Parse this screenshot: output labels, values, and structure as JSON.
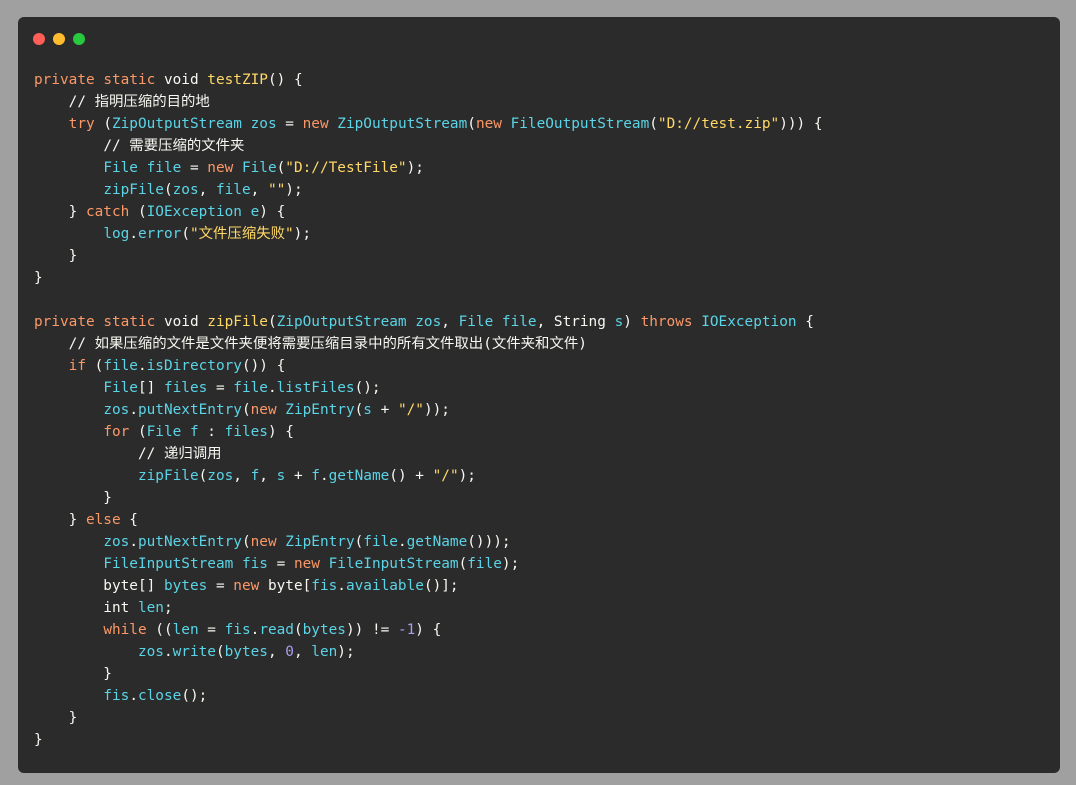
{
  "window": {
    "dots": [
      {
        "name": "close-dot",
        "color": "#ff5f56"
      },
      {
        "name": "minimize-dot",
        "color": "#ffbd2e"
      },
      {
        "name": "maximize-dot",
        "color": "#27c93f"
      }
    ]
  },
  "colors": {
    "background": "#2b2b2b",
    "keyword": "#fc9867",
    "function": "#ffd866",
    "type": "#5ad4e6",
    "string": "#ffd866",
    "number": "#ab9df2",
    "plain": "#f8f8f2"
  },
  "code": {
    "lines": [
      [
        [
          "kw",
          "private"
        ],
        [
          "pl",
          " "
        ],
        [
          "kw",
          "static"
        ],
        [
          "pl",
          " void "
        ],
        [
          "fn",
          "testZIP"
        ],
        [
          "pl",
          "() {"
        ]
      ],
      [
        [
          "pl",
          "    "
        ],
        [
          "cm",
          "// 指明压缩的目的地"
        ]
      ],
      [
        [
          "pl",
          "    "
        ],
        [
          "kw",
          "try"
        ],
        [
          "pl",
          " ("
        ],
        [
          "type",
          "ZipOutputStream"
        ],
        [
          "pl",
          " "
        ],
        [
          "var",
          "zos"
        ],
        [
          "pl",
          " = "
        ],
        [
          "kw",
          "new"
        ],
        [
          "pl",
          " "
        ],
        [
          "type",
          "ZipOutputStream"
        ],
        [
          "pl",
          "("
        ],
        [
          "kw",
          "new"
        ],
        [
          "pl",
          " "
        ],
        [
          "type",
          "FileOutputStream"
        ],
        [
          "pl",
          "("
        ],
        [
          "str",
          "\"D://test.zip\""
        ],
        [
          "pl",
          ")))"
        ],
        [
          "pl",
          " {"
        ]
      ],
      [
        [
          "pl",
          "        "
        ],
        [
          "cm",
          "// 需要压缩的文件夹"
        ]
      ],
      [
        [
          "pl",
          "        "
        ],
        [
          "type",
          "File"
        ],
        [
          "pl",
          " "
        ],
        [
          "var",
          "file"
        ],
        [
          "pl",
          " = "
        ],
        [
          "kw",
          "new"
        ],
        [
          "pl",
          " "
        ],
        [
          "type",
          "File"
        ],
        [
          "pl",
          "("
        ],
        [
          "str",
          "\"D://TestFile\""
        ],
        [
          "pl",
          ");"
        ]
      ],
      [
        [
          "pl",
          "        "
        ],
        [
          "var",
          "zipFile"
        ],
        [
          "pl",
          "("
        ],
        [
          "var",
          "zos"
        ],
        [
          "pl",
          ", "
        ],
        [
          "var",
          "file"
        ],
        [
          "pl",
          ", "
        ],
        [
          "str",
          "\"\""
        ],
        [
          "pl",
          ");"
        ]
      ],
      [
        [
          "pl",
          "    } "
        ],
        [
          "kw",
          "catch"
        ],
        [
          "pl",
          " ("
        ],
        [
          "type",
          "IOException"
        ],
        [
          "pl",
          " "
        ],
        [
          "var",
          "e"
        ],
        [
          "pl",
          ") {"
        ]
      ],
      [
        [
          "pl",
          "        "
        ],
        [
          "var",
          "log"
        ],
        [
          "pl",
          "."
        ],
        [
          "var",
          "error"
        ],
        [
          "pl",
          "("
        ],
        [
          "str",
          "\"文件压缩失败\""
        ],
        [
          "pl",
          ");"
        ]
      ],
      [
        [
          "pl",
          "    }"
        ]
      ],
      [
        [
          "pl",
          "}"
        ]
      ],
      [
        [
          "pl",
          ""
        ]
      ],
      [
        [
          "kw",
          "private"
        ],
        [
          "pl",
          " "
        ],
        [
          "kw",
          "static"
        ],
        [
          "pl",
          " void "
        ],
        [
          "fn",
          "zipFile"
        ],
        [
          "pl",
          "("
        ],
        [
          "type",
          "ZipOutputStream"
        ],
        [
          "pl",
          " "
        ],
        [
          "var",
          "zos"
        ],
        [
          "pl",
          ", "
        ],
        [
          "type",
          "File"
        ],
        [
          "pl",
          " "
        ],
        [
          "var",
          "file"
        ],
        [
          "pl",
          ", String "
        ],
        [
          "var",
          "s"
        ],
        [
          "pl",
          ") "
        ],
        [
          "kw",
          "throws"
        ],
        [
          "pl",
          " "
        ],
        [
          "type",
          "IOException"
        ],
        [
          "pl",
          " {"
        ]
      ],
      [
        [
          "pl",
          "    "
        ],
        [
          "cm",
          "// 如果压缩的文件是文件夹便将需要压缩目录中的所有文件取出(文件夹和文件)"
        ]
      ],
      [
        [
          "pl",
          "    "
        ],
        [
          "kw",
          "if"
        ],
        [
          "pl",
          " ("
        ],
        [
          "var",
          "file"
        ],
        [
          "pl",
          "."
        ],
        [
          "var",
          "isDirectory"
        ],
        [
          "pl",
          "()) {"
        ]
      ],
      [
        [
          "pl",
          "        "
        ],
        [
          "type",
          "File"
        ],
        [
          "pl",
          "[] "
        ],
        [
          "var",
          "files"
        ],
        [
          "pl",
          " = "
        ],
        [
          "var",
          "file"
        ],
        [
          "pl",
          "."
        ],
        [
          "var",
          "listFiles"
        ],
        [
          "pl",
          "();"
        ]
      ],
      [
        [
          "pl",
          "        "
        ],
        [
          "var",
          "zos"
        ],
        [
          "pl",
          "."
        ],
        [
          "var",
          "putNextEntry"
        ],
        [
          "pl",
          "("
        ],
        [
          "kw",
          "new"
        ],
        [
          "pl",
          " "
        ],
        [
          "type",
          "ZipEntry"
        ],
        [
          "pl",
          "("
        ],
        [
          "var",
          "s"
        ],
        [
          "pl",
          " + "
        ],
        [
          "str",
          "\"/\""
        ],
        [
          "pl",
          "));"
        ]
      ],
      [
        [
          "pl",
          "        "
        ],
        [
          "kw",
          "for"
        ],
        [
          "pl",
          " ("
        ],
        [
          "type",
          "File"
        ],
        [
          "pl",
          " "
        ],
        [
          "var",
          "f"
        ],
        [
          "pl",
          " : "
        ],
        [
          "var",
          "files"
        ],
        [
          "pl",
          ") {"
        ]
      ],
      [
        [
          "pl",
          "            "
        ],
        [
          "cm",
          "// 递归调用"
        ]
      ],
      [
        [
          "pl",
          "            "
        ],
        [
          "var",
          "zipFile"
        ],
        [
          "pl",
          "("
        ],
        [
          "var",
          "zos"
        ],
        [
          "pl",
          ", "
        ],
        [
          "var",
          "f"
        ],
        [
          "pl",
          ", "
        ],
        [
          "var",
          "s"
        ],
        [
          "pl",
          " + "
        ],
        [
          "var",
          "f"
        ],
        [
          "pl",
          "."
        ],
        [
          "var",
          "getName"
        ],
        [
          "pl",
          "() + "
        ],
        [
          "str",
          "\"/\""
        ],
        [
          "pl",
          ");"
        ]
      ],
      [
        [
          "pl",
          "        }"
        ]
      ],
      [
        [
          "pl",
          "    } "
        ],
        [
          "kw",
          "else"
        ],
        [
          "pl",
          " {"
        ]
      ],
      [
        [
          "pl",
          "        "
        ],
        [
          "var",
          "zos"
        ],
        [
          "pl",
          "."
        ],
        [
          "var",
          "putNextEntry"
        ],
        [
          "pl",
          "("
        ],
        [
          "kw",
          "new"
        ],
        [
          "pl",
          " "
        ],
        [
          "type",
          "ZipEntry"
        ],
        [
          "pl",
          "("
        ],
        [
          "var",
          "file"
        ],
        [
          "pl",
          "."
        ],
        [
          "var",
          "getName"
        ],
        [
          "pl",
          "()));"
        ]
      ],
      [
        [
          "pl",
          "        "
        ],
        [
          "type",
          "FileInputStream"
        ],
        [
          "pl",
          " "
        ],
        [
          "var",
          "fis"
        ],
        [
          "pl",
          " = "
        ],
        [
          "kw",
          "new"
        ],
        [
          "pl",
          " "
        ],
        [
          "type",
          "FileInputStream"
        ],
        [
          "pl",
          "("
        ],
        [
          "var",
          "file"
        ],
        [
          "pl",
          ");"
        ]
      ],
      [
        [
          "pl",
          "        byte[] "
        ],
        [
          "var",
          "bytes"
        ],
        [
          "pl",
          " = "
        ],
        [
          "kw",
          "new"
        ],
        [
          "pl",
          " byte["
        ],
        [
          "var",
          "fis"
        ],
        [
          "pl",
          "."
        ],
        [
          "var",
          "available"
        ],
        [
          "pl",
          "()];"
        ]
      ],
      [
        [
          "pl",
          "        int "
        ],
        [
          "var",
          "len"
        ],
        [
          "pl",
          ";"
        ]
      ],
      [
        [
          "pl",
          "        "
        ],
        [
          "kw",
          "while"
        ],
        [
          "pl",
          " (("
        ],
        [
          "var",
          "len"
        ],
        [
          "pl",
          " = "
        ],
        [
          "var",
          "fis"
        ],
        [
          "pl",
          "."
        ],
        [
          "var",
          "read"
        ],
        [
          "pl",
          "("
        ],
        [
          "var",
          "bytes"
        ],
        [
          "pl",
          ")) != "
        ],
        [
          "num",
          "-1"
        ],
        [
          "pl",
          ") {"
        ]
      ],
      [
        [
          "pl",
          "            "
        ],
        [
          "var",
          "zos"
        ],
        [
          "pl",
          "."
        ],
        [
          "var",
          "write"
        ],
        [
          "pl",
          "("
        ],
        [
          "var",
          "bytes"
        ],
        [
          "pl",
          ", "
        ],
        [
          "num",
          "0"
        ],
        [
          "pl",
          ", "
        ],
        [
          "var",
          "len"
        ],
        [
          "pl",
          ");"
        ]
      ],
      [
        [
          "pl",
          "        }"
        ]
      ],
      [
        [
          "pl",
          "        "
        ],
        [
          "var",
          "fis"
        ],
        [
          "pl",
          "."
        ],
        [
          "var",
          "close"
        ],
        [
          "pl",
          "();"
        ]
      ],
      [
        [
          "pl",
          "    }"
        ]
      ],
      [
        [
          "pl",
          "}"
        ]
      ]
    ]
  }
}
